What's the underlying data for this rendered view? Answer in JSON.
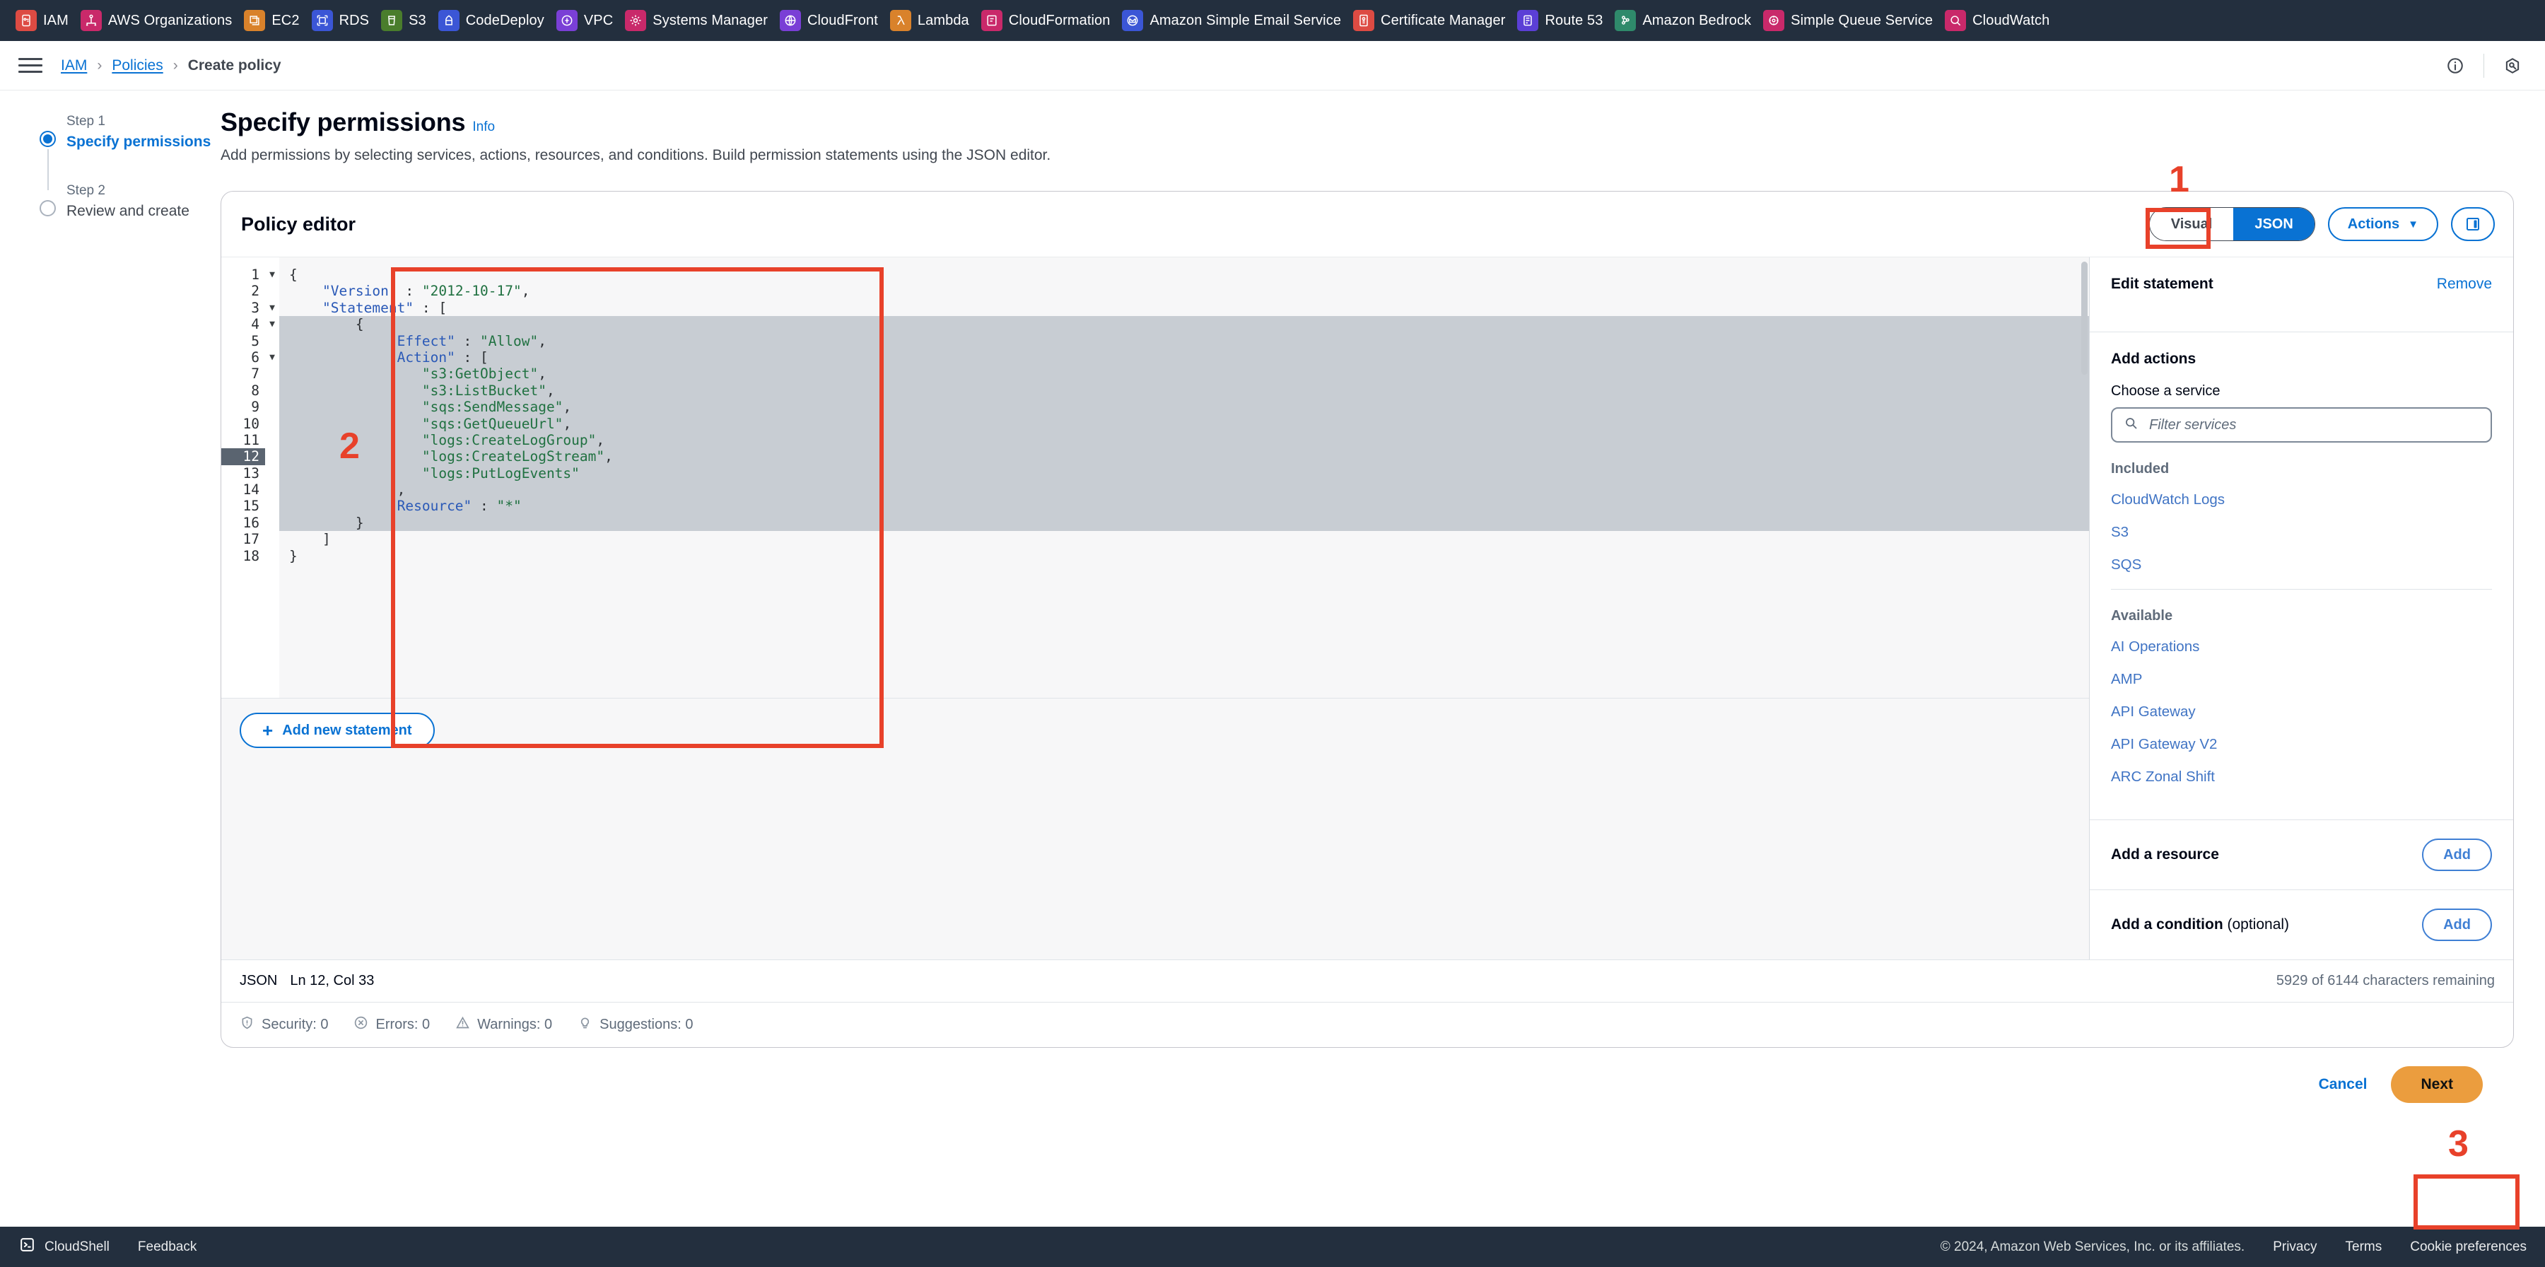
{
  "service_bar": [
    {
      "label": "IAM",
      "icon": "iam-icon",
      "color": "#dd4b43"
    },
    {
      "label": "AWS Organizations",
      "icon": "organizations-icon",
      "color": "#c9296a"
    },
    {
      "label": "EC2",
      "icon": "ec2-icon",
      "color": "#d9822b"
    },
    {
      "label": "RDS",
      "icon": "rds-icon",
      "color": "#3b56d6"
    },
    {
      "label": "S3",
      "icon": "s3-icon",
      "color": "#4a7d2c"
    },
    {
      "label": "CodeDeploy",
      "icon": "codedeploy-icon",
      "color": "#3b56d6"
    },
    {
      "label": "VPC",
      "icon": "vpc-icon",
      "color": "#7a3fd6"
    },
    {
      "label": "Systems Manager",
      "icon": "systems-manager-icon",
      "color": "#c9296a"
    },
    {
      "label": "CloudFront",
      "icon": "cloudfront-icon",
      "color": "#7a3fd6"
    },
    {
      "label": "Lambda",
      "icon": "lambda-icon",
      "color": "#d9822b"
    },
    {
      "label": "CloudFormation",
      "icon": "cloudformation-icon",
      "color": "#c9296a"
    },
    {
      "label": "Amazon Simple Email Service",
      "icon": "ses-icon",
      "color": "#3b56d6"
    },
    {
      "label": "Certificate Manager",
      "icon": "certificate-manager-icon",
      "color": "#dd4b43"
    },
    {
      "label": "Route 53",
      "icon": "route53-icon",
      "color": "#5b3fd6"
    },
    {
      "label": "Amazon Bedrock",
      "icon": "bedrock-icon",
      "color": "#2f8a6b"
    },
    {
      "label": "Simple Queue Service",
      "icon": "sqs-icon",
      "color": "#c9296a"
    },
    {
      "label": "CloudWatch",
      "icon": "cloudwatch-icon",
      "color": "#c9296a"
    }
  ],
  "breadcrumb": {
    "items": [
      "IAM",
      "Policies",
      "Create policy"
    ],
    "separator": "›"
  },
  "wizard": {
    "step1_kicker": "Step 1",
    "step1_label": "Specify permissions",
    "step2_kicker": "Step 2",
    "step2_label": "Review and create"
  },
  "header": {
    "title": "Specify permissions",
    "info_label": "Info",
    "subtitle": "Add permissions by selecting services, actions, resources, and conditions. Build permission statements using the JSON editor."
  },
  "editor_card": {
    "title": "Policy editor",
    "toggle": {
      "visual": "Visual",
      "json": "JSON",
      "selected": "JSON"
    },
    "actions_label": "Actions",
    "actions_caret": "▼"
  },
  "code": {
    "language": "JSON",
    "cursor": "Ln 12, Col 33",
    "chars_remaining": "5929 of 6144 characters remaining",
    "current_line": 12,
    "selected_lines": [
      4,
      5,
      6,
      7,
      8,
      9,
      10,
      11,
      12,
      13,
      14,
      15,
      16
    ],
    "fold_lines": [
      1,
      3,
      4,
      6
    ],
    "lines": [
      {
        "n": 1,
        "text": "{"
      },
      {
        "n": 2,
        "text": "    \"Version\" : \"2012-10-17\","
      },
      {
        "n": 3,
        "text": "    \"Statement\" : ["
      },
      {
        "n": 4,
        "text": "        {"
      },
      {
        "n": 5,
        "text": "            \"Effect\" : \"Allow\","
      },
      {
        "n": 6,
        "text": "            \"Action\" : ["
      },
      {
        "n": 7,
        "text": "                \"s3:GetObject\","
      },
      {
        "n": 8,
        "text": "                \"s3:ListBucket\","
      },
      {
        "n": 9,
        "text": "                \"sqs:SendMessage\","
      },
      {
        "n": 10,
        "text": "                \"sqs:GetQueueUrl\","
      },
      {
        "n": 11,
        "text": "                \"logs:CreateLogGroup\","
      },
      {
        "n": 12,
        "text": "                \"logs:CreateLogStream\","
      },
      {
        "n": 13,
        "text": "                \"logs:PutLogEvents\""
      },
      {
        "n": 14,
        "text": "            ],"
      },
      {
        "n": 15,
        "text": "            \"Resource\" : \"*\""
      },
      {
        "n": 16,
        "text": "        }"
      },
      {
        "n": 17,
        "text": "    ]"
      },
      {
        "n": 18,
        "text": "}"
      }
    ]
  },
  "side_panel": {
    "edit_statement": "Edit statement",
    "remove": "Remove",
    "add_actions": "Add actions",
    "choose_service_label": "Choose a service",
    "filter_placeholder": "Filter services",
    "included_heading": "Included",
    "included": [
      "CloudWatch Logs",
      "S3",
      "SQS"
    ],
    "available_heading": "Available",
    "available": [
      "AI Operations",
      "AMP",
      "API Gateway",
      "API Gateway V2",
      "ARC Zonal Shift"
    ],
    "add_resource_label": "Add a resource",
    "add_resource_btn": "Add",
    "add_condition_label": "Add a condition",
    "add_condition_optional": "(optional)",
    "add_condition_btn": "Add"
  },
  "footer_bar": {
    "add_new_statement": "Add new statement",
    "diagnostics": [
      {
        "label": "Security: 0",
        "icon": "shield-icon"
      },
      {
        "label": "Errors: 0",
        "icon": "error-circle-icon"
      },
      {
        "label": "Warnings: 0",
        "icon": "warning-triangle-icon"
      },
      {
        "label": "Suggestions: 0",
        "icon": "lightbulb-icon"
      }
    ]
  },
  "bottom": {
    "cancel": "Cancel",
    "next": "Next"
  },
  "page_footer": {
    "cloudshell": "CloudShell",
    "feedback": "Feedback",
    "copyright": "© 2024, Amazon Web Services, Inc. or its affiliates.",
    "privacy": "Privacy",
    "terms": "Terms",
    "cookie_preferences": "Cookie preferences"
  },
  "annotations": {
    "one": "1",
    "two": "2",
    "three": "3",
    "color": "#e8412a"
  }
}
